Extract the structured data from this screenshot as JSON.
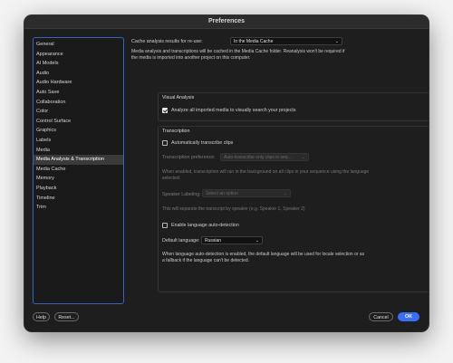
{
  "window": {
    "title": "Preferences"
  },
  "sidebar": {
    "items": [
      "General",
      "Appearance",
      "AI Models",
      "Audio",
      "Audio Hardware",
      "Auto Save",
      "Collaboration",
      "Color",
      "Control Surface",
      "Graphics",
      "Labels",
      "Media",
      "Media Analysis & Transcription",
      "Media Cache",
      "Memory",
      "Playback",
      "Timeline",
      "Trim"
    ],
    "active_index": 12
  },
  "cache": {
    "label": "Cache analysis results for re-use:",
    "value": "In the Media Cache",
    "description": "Media analysis and transcriptions will be cached in the Media Cache folder. Reanalysis won't be required if the media is imported into another project on this computer."
  },
  "visual_analysis": {
    "title": "Visual Analysis",
    "analyze_label": "Analyze all imported media to visually search your projects",
    "analyze_checked": true
  },
  "transcription": {
    "title": "Transcription",
    "auto_label": "Automatically transcribe clips",
    "auto_checked": false,
    "preference_label": "Transcription preference:",
    "preference_value": "Auto-transcribe only clips in seq...",
    "preference_desc": "When enabled, transcription will run in the background on all clips in your sequence using the language selected.",
    "speaker_label": "Speaker Labeling:",
    "speaker_value": "Select an option",
    "speaker_desc": "This will separate the transcript by speaker (e.g. Speaker 1, Speaker 2)",
    "lang_detect_label": "Enable language auto-detection",
    "lang_detect_checked": false,
    "default_lang_label": "Default language:",
    "default_lang_value": "Russian",
    "default_lang_desc": "When language auto-detection is enabled, the default language will be used for locale selection or as a fallback if the language can't be detected."
  },
  "footer": {
    "help": "Help",
    "reset": "Reset...",
    "cancel": "Cancel",
    "ok": "OK"
  },
  "colors": {
    "accent": "#3b6ef5",
    "sidebar_border": "#3b63b8",
    "window_bg": "#1e1e1e"
  }
}
